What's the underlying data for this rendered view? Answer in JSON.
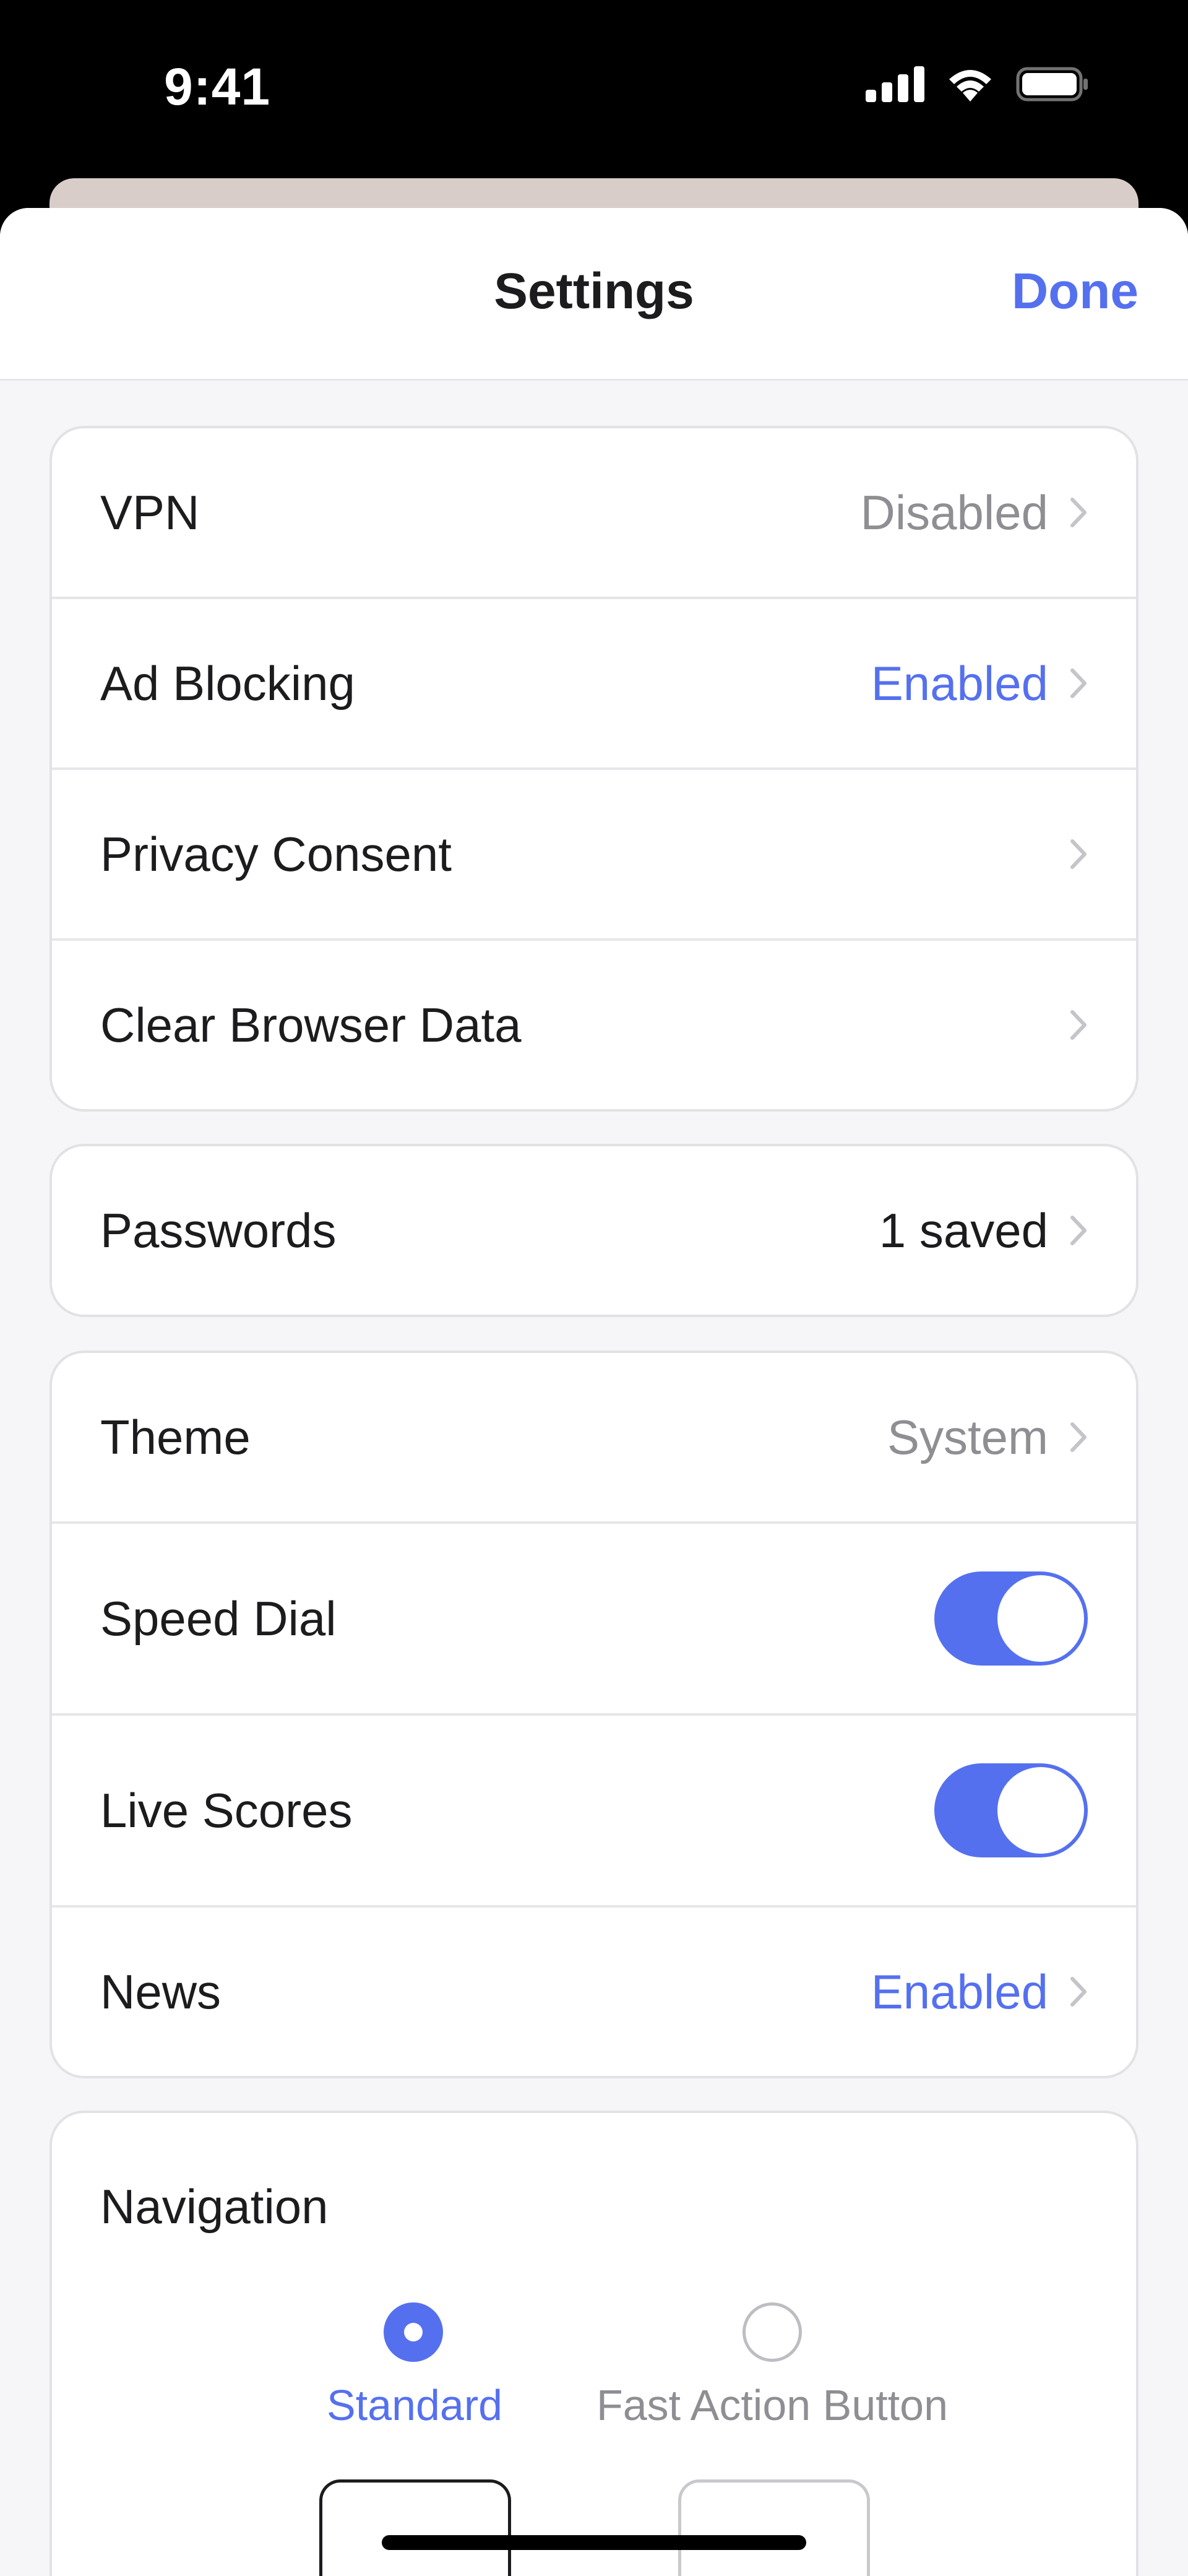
{
  "status_bar": {
    "time": "9:41"
  },
  "header": {
    "title": "Settings",
    "done_label": "Done"
  },
  "group1": [
    {
      "label": "VPN",
      "value": "Disabled",
      "value_style": "gray"
    },
    {
      "label": "Ad Blocking",
      "value": "Enabled",
      "value_style": "blue"
    },
    {
      "label": "Privacy Consent",
      "value": ""
    },
    {
      "label": "Clear Browser Data",
      "value": ""
    }
  ],
  "group2": [
    {
      "label": "Passwords",
      "value": "1 saved",
      "value_style": "dark"
    }
  ],
  "group3": {
    "theme": {
      "label": "Theme",
      "value": "System"
    },
    "speed_dial": {
      "label": "Speed Dial",
      "on": true
    },
    "live_scores": {
      "label": "Live Scores",
      "on": true
    },
    "news": {
      "label": "News",
      "value": "Enabled"
    }
  },
  "navigation": {
    "title": "Navigation",
    "options": [
      {
        "label": "Standard",
        "selected": true
      },
      {
        "label": "Fast Action Button",
        "selected": false
      }
    ]
  },
  "colors": {
    "accent": "#5570ef",
    "secondary_text": "#8e8e93",
    "background": "#f6f6f8"
  },
  "icons": [
    "signal-icon",
    "wifi-icon",
    "battery-icon",
    "chevron-right-icon"
  ]
}
